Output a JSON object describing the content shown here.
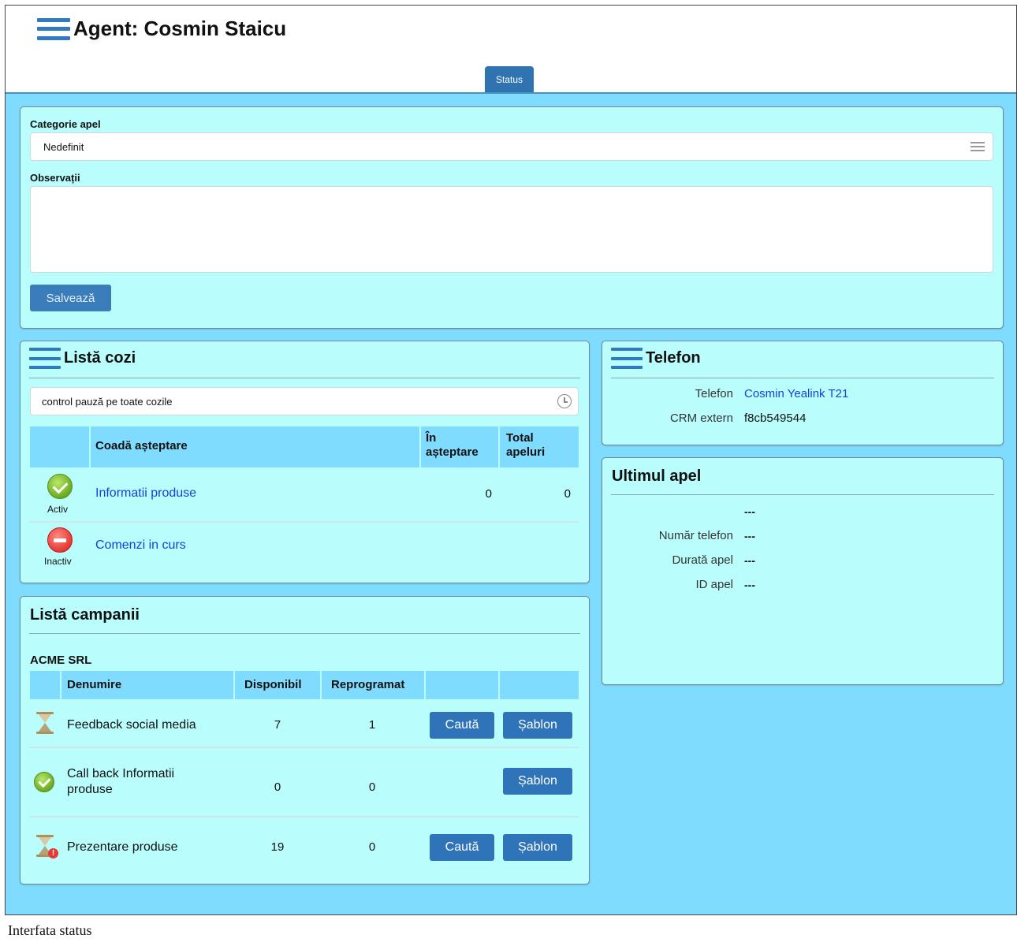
{
  "header": {
    "title": "Agent: Cosmin Staicu",
    "tab_status": "Status"
  },
  "call_form": {
    "category_label": "Categorie apel",
    "category_value": "Nedefinit",
    "notes_label": "Observații",
    "notes_value": "",
    "save_label": "Salvează"
  },
  "queues": {
    "title": "Listă cozi",
    "pause_control": "control pauză pe toate cozile",
    "columns": {
      "queue": "Coadă așteptare",
      "waiting_1": "În",
      "waiting_2": "așteptare",
      "total_1": "Total",
      "total_2": "apeluri"
    },
    "rows": [
      {
        "state": "Activ",
        "name": "Informatii produse",
        "waiting": "0",
        "total": "0"
      },
      {
        "state": "Inactiv",
        "name": "Comenzi in curs",
        "waiting": "",
        "total": ""
      }
    ]
  },
  "campaigns": {
    "title": "Listă campanii",
    "group": "ACME SRL",
    "columns": {
      "name": "Denumire",
      "available": "Disponibil",
      "rescheduled": "Reprogramat"
    },
    "rows": [
      {
        "icon": "hourglass-icon",
        "name": "Feedback social media",
        "available": "7",
        "rescheduled": "1",
        "search": "Caută",
        "template": "Șablon"
      },
      {
        "icon": "check-circle-icon",
        "name_line1": "Call back Informatii",
        "name_line2": "produse",
        "available": "0",
        "rescheduled": "0",
        "template": "Șablon"
      },
      {
        "icon": "hourglass-warning-icon",
        "name": "Prezentare produse",
        "available": "19",
        "rescheduled": "0",
        "search": "Caută",
        "template": "Șablon"
      }
    ]
  },
  "phone": {
    "title": "Telefon",
    "phone_key": "Telefon",
    "phone_value": "Cosmin Yealink T21",
    "crm_key": "CRM extern",
    "crm_value": "f8cb549544"
  },
  "last_call": {
    "title": "Ultimul apel",
    "top_value": "---",
    "number_key": "Număr telefon",
    "number_value": "---",
    "duration_key": "Durată apel",
    "duration_value": "---",
    "id_key": "ID apel",
    "id_value": "---"
  },
  "caption": "Interfata status",
  "colors": {
    "main_bg": "#7fdcff",
    "panel_bg": "#b9fdfd",
    "accent": "#2f73b8",
    "link": "#1a3fd8"
  }
}
